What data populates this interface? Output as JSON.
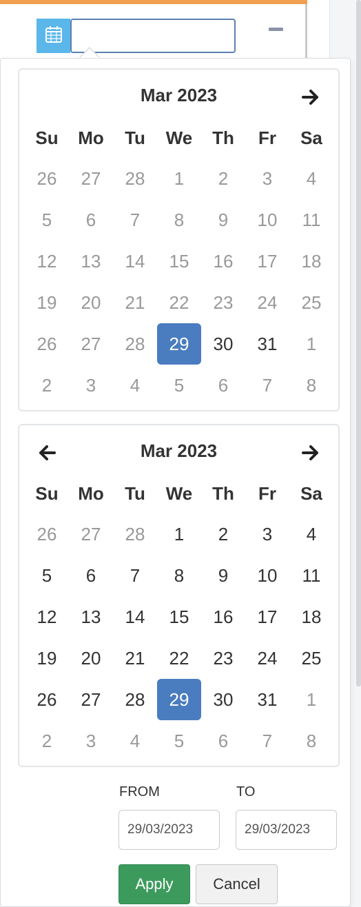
{
  "header": {
    "date_input_value": "",
    "calendar_icon": "calendar-icon",
    "collapse_icon": "minus-icon"
  },
  "colors": {
    "accent_bar": "#f0a050",
    "calendar_button": "#5bb7ea",
    "selected_day": "#4a7cc0",
    "apply_button": "#3d9a5d"
  },
  "left_calendar": {
    "month_label": "Mar 2023",
    "next_icon": "arrow-right-icon",
    "days_of_week": [
      "Su",
      "Mo",
      "Tu",
      "We",
      "Th",
      "Fr",
      "Sa"
    ],
    "weeks": [
      [
        {
          "d": "26",
          "off": true
        },
        {
          "d": "27",
          "off": true
        },
        {
          "d": "28",
          "off": true
        },
        {
          "d": "1",
          "off": true
        },
        {
          "d": "2",
          "off": true
        },
        {
          "d": "3",
          "off": true
        },
        {
          "d": "4",
          "off": true
        }
      ],
      [
        {
          "d": "5",
          "off": true
        },
        {
          "d": "6",
          "off": true
        },
        {
          "d": "7",
          "off": true
        },
        {
          "d": "8",
          "off": true
        },
        {
          "d": "9",
          "off": true
        },
        {
          "d": "10",
          "off": true
        },
        {
          "d": "11",
          "off": true
        }
      ],
      [
        {
          "d": "12",
          "off": true
        },
        {
          "d": "13",
          "off": true
        },
        {
          "d": "14",
          "off": true
        },
        {
          "d": "15",
          "off": true
        },
        {
          "d": "16",
          "off": true
        },
        {
          "d": "17",
          "off": true
        },
        {
          "d": "18",
          "off": true
        }
      ],
      [
        {
          "d": "19",
          "off": true
        },
        {
          "d": "20",
          "off": true
        },
        {
          "d": "21",
          "off": true
        },
        {
          "d": "22",
          "off": true
        },
        {
          "d": "23",
          "off": true
        },
        {
          "d": "24",
          "off": true
        },
        {
          "d": "25",
          "off": true
        }
      ],
      [
        {
          "d": "26",
          "off": true
        },
        {
          "d": "27",
          "off": true
        },
        {
          "d": "28",
          "off": true
        },
        {
          "d": "29",
          "sel": true
        },
        {
          "d": "30"
        },
        {
          "d": "31"
        },
        {
          "d": "1",
          "off": true
        }
      ],
      [
        {
          "d": "2",
          "off": true
        },
        {
          "d": "3",
          "off": true
        },
        {
          "d": "4",
          "off": true
        },
        {
          "d": "5",
          "off": true
        },
        {
          "d": "6",
          "off": true
        },
        {
          "d": "7",
          "off": true
        },
        {
          "d": "8",
          "off": true
        }
      ]
    ]
  },
  "right_calendar": {
    "month_label": "Mar 2023",
    "prev_icon": "arrow-left-icon",
    "next_icon": "arrow-right-icon",
    "days_of_week": [
      "Su",
      "Mo",
      "Tu",
      "We",
      "Th",
      "Fr",
      "Sa"
    ],
    "weeks": [
      [
        {
          "d": "26",
          "off": true
        },
        {
          "d": "27",
          "off": true
        },
        {
          "d": "28",
          "off": true
        },
        {
          "d": "1"
        },
        {
          "d": "2"
        },
        {
          "d": "3"
        },
        {
          "d": "4"
        }
      ],
      [
        {
          "d": "5"
        },
        {
          "d": "6"
        },
        {
          "d": "7"
        },
        {
          "d": "8"
        },
        {
          "d": "9"
        },
        {
          "d": "10"
        },
        {
          "d": "11"
        }
      ],
      [
        {
          "d": "12"
        },
        {
          "d": "13"
        },
        {
          "d": "14"
        },
        {
          "d": "15"
        },
        {
          "d": "16"
        },
        {
          "d": "17"
        },
        {
          "d": "18"
        }
      ],
      [
        {
          "d": "19"
        },
        {
          "d": "20"
        },
        {
          "d": "21"
        },
        {
          "d": "22"
        },
        {
          "d": "23"
        },
        {
          "d": "24"
        },
        {
          "d": "25"
        }
      ],
      [
        {
          "d": "26"
        },
        {
          "d": "27"
        },
        {
          "d": "28"
        },
        {
          "d": "29",
          "sel": true
        },
        {
          "d": "30"
        },
        {
          "d": "31"
        },
        {
          "d": "1",
          "off": true
        }
      ],
      [
        {
          "d": "2",
          "off": true
        },
        {
          "d": "3",
          "off": true
        },
        {
          "d": "4",
          "off": true
        },
        {
          "d": "5",
          "off": true
        },
        {
          "d": "6",
          "off": true
        },
        {
          "d": "7",
          "off": true
        },
        {
          "d": "8",
          "off": true
        }
      ]
    ]
  },
  "range": {
    "from_label": "FROM",
    "from_value": "29/03/2023",
    "to_label": "TO",
    "to_value": "29/03/2023"
  },
  "actions": {
    "apply_label": "Apply",
    "cancel_label": "Cancel"
  }
}
